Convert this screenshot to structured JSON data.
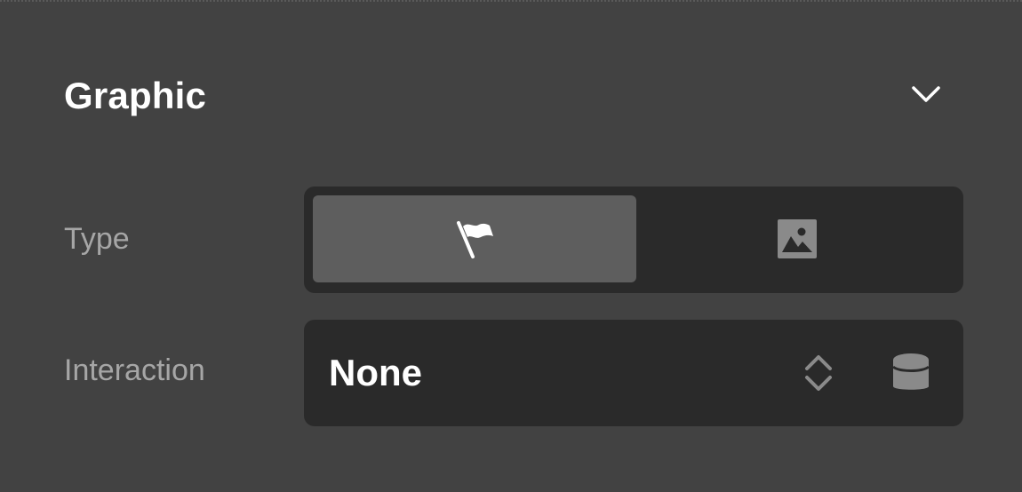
{
  "section": {
    "title": "Graphic",
    "collapse_icon": "chevron-down-icon"
  },
  "type_row": {
    "label": "Type",
    "options": [
      {
        "icon": "flag-icon",
        "selected": true
      },
      {
        "icon": "image-icon",
        "selected": false
      }
    ]
  },
  "interaction_row": {
    "label": "Interaction",
    "value": "None",
    "arrows_icon": "chevron-up-down-icon",
    "data_icon": "database-icon"
  },
  "colors": {
    "panel_bg": "#424242",
    "control_bg": "#2a2a2a",
    "selected_bg": "#5e5e5e",
    "label_text": "#a6a6a6",
    "icon_muted": "#8a8a8a"
  }
}
